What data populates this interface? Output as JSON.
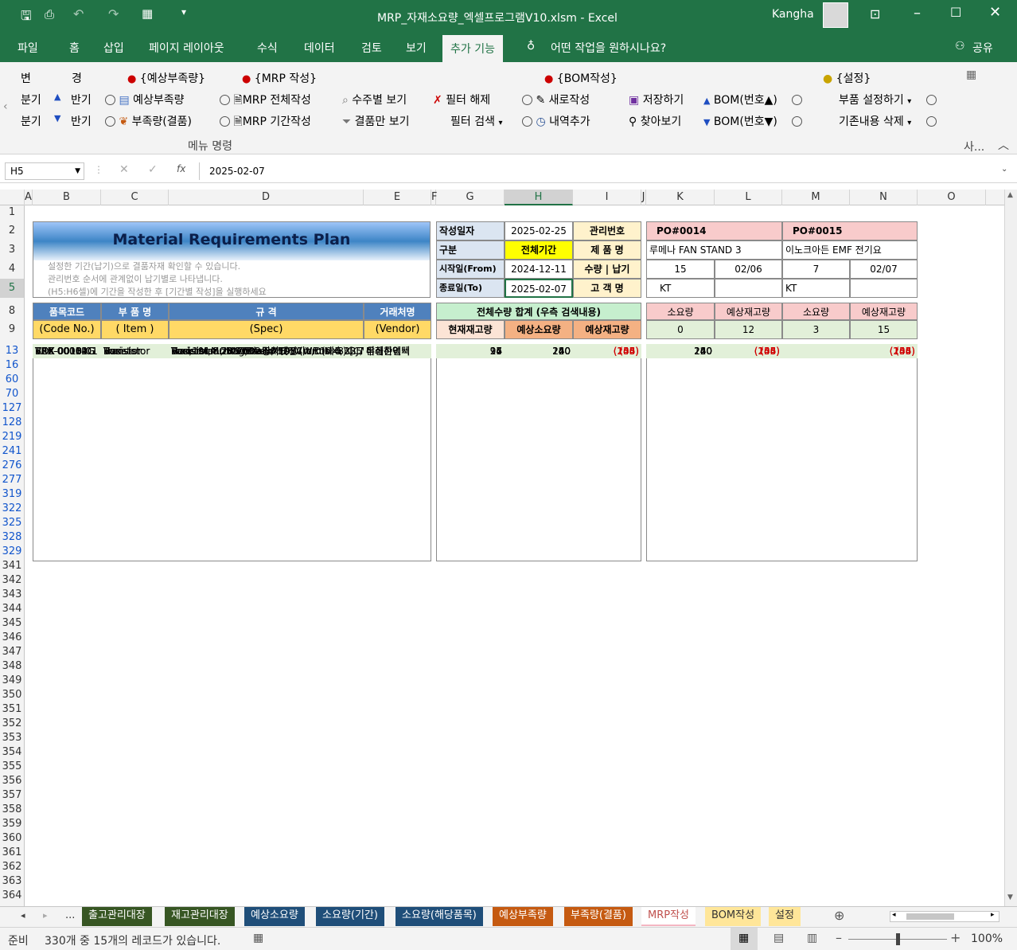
{
  "title_bar": {
    "title": "MRP_자재소요량_엑셀프로그램V10.xlsm  -  Excel",
    "user": "Kangha"
  },
  "tabs": [
    "파일",
    "홈",
    "삽입",
    "페이지 레이아웃",
    "수식",
    "데이터",
    "검토",
    "보기",
    "추가 기능"
  ],
  "tell_me": "어떤 작업을 원하시나요?",
  "share": "공유",
  "ribbon": {
    "r1": [
      "변",
      "경"
    ],
    "r2": [
      "분기",
      "반기"
    ],
    "r3": [
      "분기",
      "반기"
    ],
    "h1": "{예상부족량}",
    "h2": "{MRP 작성}",
    "h3": "{BOM작성}",
    "h4": "{설정}",
    "b1": "예상부족량",
    "b2": "부족량(결품)",
    "b3": "MRP 전체작성",
    "b4": "MRP 기간작성",
    "b5": "수주별 보기",
    "b6": "결품만 보기",
    "b7": "필터 해제",
    "b8": "필터 검색",
    "b9": "새로작성",
    "b10": "내역추가",
    "b11": "저장하기",
    "b12": "찾아보기",
    "b13": "BOM(번호▲)",
    "b14": "BOM(번호▼)",
    "b15": "부품 설정하기",
    "b16": "기존내용 삭제",
    "group": "메뉴 명령",
    "more": "사..."
  },
  "formula": {
    "name_box": "H5",
    "value": "2025-02-07",
    "fx": "fx"
  },
  "columns": [
    "A",
    "B",
    "C",
    "D",
    "E",
    "F",
    "G",
    "H",
    "I",
    "J",
    "K",
    "L",
    "M",
    "N",
    "O"
  ],
  "rows": [
    "1",
    "2",
    "3",
    "4",
    "5",
    "8",
    "9",
    "13",
    "16",
    "60",
    "70",
    "127",
    "128",
    "219",
    "241",
    "276",
    "277",
    "319",
    "322",
    "325",
    "328",
    "329",
    "341",
    "342",
    "343",
    "344",
    "345",
    "346",
    "347",
    "348",
    "349",
    "350",
    "351",
    "352",
    "353",
    "354",
    "355",
    "356",
    "357",
    "358",
    "359",
    "360",
    "361",
    "362",
    "363",
    "364"
  ],
  "sheet": {
    "title": "Material Requirements Plan",
    "notes": [
      "설정한 기간(납기)으로 결품자재 확인할 수 있습니다.",
      "관리번호 순서에 관계없이 납기별로 나타냅니다.",
      "(H5:H6셀)에 기간을 작성한 후 [기간별 작성]을 실행하세요"
    ],
    "info": {
      "l1": "작성일자",
      "v1": "2025-02-25",
      "r1": "관리번호",
      "l2": "구분",
      "v2": "전체기간",
      "r2": "제 품 명",
      "l3": "시작일(From)",
      "v3": "2024-12-11",
      "r3": "수량 | 납기",
      "l4": "종료일(To)",
      "v4": "2025-02-07",
      "r4": "고 객 명"
    },
    "po": [
      {
        "no": "PO#0014",
        "product": "루메나 FAN STAND 3",
        "qty": "15",
        "due": "02/06",
        "customer": "KT"
      },
      {
        "no": "PO#0015",
        "product": "이노크아든 EMF 전기요",
        "qty": "7",
        "due": "02/07",
        "customer": "KT"
      }
    ],
    "hdr": {
      "code": "품목코드",
      "item": "부 품 명",
      "spec": "규 격",
      "vendor": "거래처명",
      "code2": "(Code No.)",
      "item2": "( Item )",
      "spec2": "(Spec)",
      "vendor2": "(Vendor)",
      "total": "전체수량 합계 (우측 검색내용)",
      "stock": "현재재고량",
      "need": "예상소요량",
      "expect": "예상재고량",
      "k": "소요량",
      "l": "예상재고량",
      "m": "소요량",
      "n": "예상재고량",
      "k9": "0",
      "l9": "12",
      "m9": "3",
      "n9": "15"
    },
    "data": [
      [
        "CAB-1001",
        "Cable",
        "Data Cable, Modem Cable, 6 Ft, DB9 F>",
        "LS산전",
        "24",
        "330",
        "(306)",
        "330",
        "(306)",
        "",
        "(306)"
      ],
      [
        "CAB-1301A",
        "Cable",
        "NEMA5-15P>IEC320 / C13.6ft.10A  [NEMA",
        "LS산전",
        "8",
        "37",
        "(29)",
        "30",
        "(22)",
        "7",
        "(29)"
      ],
      [
        "CON-00255G",
        "Outlet",
        "Receptacle,60309 [Receptacle,60309]",
        "대륙전자",
        "54",
        "77",
        "(23)",
        "",
        "54",
        "77",
        "(23)"
      ],
      [
        "FUSE-0001-P2",
        "Fuse",
        "25A,125V axial-0251.250MXL-RoHS",
        "영기전자",
        "8",
        "15",
        "(7)",
        "15",
        "(7)",
        "",
        "(7)"
      ],
      [
        "HDW-50M-006",
        "Hardware",
        "Hardware, Nut, 6-32, 7 / 64 h, Zinc Plate",
        "윤성",
        "29",
        "98",
        "(69)",
        "",
        "29",
        "98",
        "(69)"
      ],
      [
        "HDW-90279A1",
        "Hardware",
        "Screw, Phil,Round,4-40x1 / 2Steel Zinc-Re",
        "윤성",
        "16",
        "105",
        "(89)",
        "",
        "16",
        "105",
        "(89)"
      ],
      [
        "ICP-01046G",
        "IC",
        "IC-MULTI-DSP V1.0A-RoHS",
        "삼성전자",
        "38",
        "300",
        "(262)",
        "300",
        "(262)",
        "",
        "(262)"
      ],
      [
        "INT-00147G",
        "Inductor",
        "Shunt Cap,1x2,P = 2 mm",
        "엘지전자",
        "12",
        "60",
        "(48)",
        "60",
        "(48)",
        "",
        "(48)"
      ],
      [
        "RES-00058G",
        "Resistor",
        "Resistor 1 / 16W 1% 5.23Kohm [SMT060",
        "삼화콘덴서",
        "99",
        "480",
        "(381)",
        "480",
        "(381)",
        "",
        "(381)"
      ],
      [
        "RES-00131G",
        "Resistor",
        "Resistor 8.2KΩ 5% 1 / 10W(WR06X822JT",
        "삼화콘덴서",
        "97",
        "240",
        "(143)",
        "240",
        "(143)",
        "",
        "(143)"
      ],
      [
        "TRX-00004G",
        "Transistor",
        "Transistor 2N 7002-SMT",
        "우신산업",
        "6",
        "240",
        "(234)",
        "240",
        "(234)",
        "",
        "(234)"
      ],
      [
        "TRX-00012G",
        "Transistor",
        "Transistor 75N08A-RoHS",
        "우신산업",
        "14",
        "120",
        "(106)",
        "120",
        "(106)",
        "",
        "(106)"
      ],
      [
        "VAR-00009G",
        "Varistor",
        "Varistor,MOV Vmax = 505V Vrms = 385V",
        "우신산업",
        "24",
        "60",
        "(36)",
        "60",
        "(36)",
        "",
        "(36)"
      ],
      [
        "BOX-0010-01",
        "Box",
        "Pack. Mat., Bag,Pla강하넷전자c,DIM 5 X",
        "미래하이텍",
        "94",
        "240",
        "(146)",
        "240",
        "(146)",
        "",
        "(146)"
      ],
      [
        "BOX-0013-01",
        "Box",
        "Box,191mmX200mmX1981mm(내측) [C/T",
        "미래하이텍",
        "95",
        "240",
        "(145)",
        "240",
        "(145)",
        "",
        "(145)"
      ]
    ]
  },
  "sheet_tabs": [
    {
      "label": "...",
      "color": "#f3f3f3"
    },
    {
      "label": "출고관리대장",
      "color": "#375623"
    },
    {
      "label": "재고관리대장",
      "color": "#375623"
    },
    {
      "label": "예상소요량",
      "color": "#1f4e79"
    },
    {
      "label": "소요량(기간)",
      "color": "#1f4e79"
    },
    {
      "label": "소요량(해당품목)",
      "color": "#1f4e79"
    },
    {
      "label": "예상부족량",
      "color": "#c55a11"
    },
    {
      "label": "부족량(결품)",
      "color": "#c55a11"
    },
    {
      "label": "MRP작성",
      "color": "#f4b6c2"
    },
    {
      "label": "BOM작성",
      "color": "#ffe699"
    },
    {
      "label": "설정",
      "color": "#ffe699"
    }
  ],
  "status": {
    "ready": "준비",
    "records": "330개 중 15개의 레코드가 있습니다.",
    "zoom": "100%"
  },
  "colors": {
    "excel_green": "#217346",
    "header_blue": "#4f81bd",
    "yellow": "#ffd966",
    "orange": "#f4b183",
    "green_light": "#e2f0d9",
    "pink": "#f8cbcb"
  }
}
